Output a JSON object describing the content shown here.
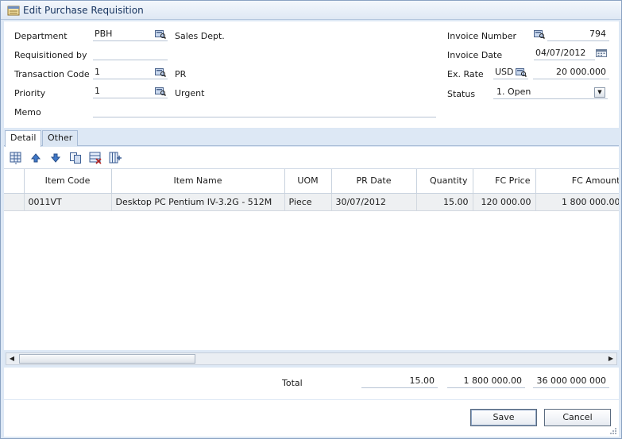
{
  "window": {
    "title": "Edit Purchase Requisition"
  },
  "form": {
    "department": {
      "label": "Department",
      "code": "PBH",
      "name": "Sales Dept."
    },
    "requisitioned_by": {
      "label": "Requisitioned by",
      "value": ""
    },
    "transaction_code": {
      "label": "Transaction Code",
      "code": "1",
      "name": "PR"
    },
    "priority": {
      "label": "Priority",
      "code": "1",
      "name": "Urgent"
    },
    "memo": {
      "label": "Memo",
      "value": ""
    },
    "invoice_number": {
      "label": "Invoice Number",
      "value": "794"
    },
    "invoice_date": {
      "label": "Invoice Date",
      "value": "04/07/2012"
    },
    "ex_rate": {
      "label": "Ex. Rate",
      "currency": "USD",
      "value": "20 000.000"
    },
    "status": {
      "label": "Status",
      "value": "1. Open"
    }
  },
  "tabs": [
    {
      "label": "Detail",
      "active": true
    },
    {
      "label": "Other",
      "active": false
    }
  ],
  "toolbar_icons": [
    "add-row-icon",
    "move-up-icon",
    "move-down-icon",
    "copy-icon",
    "delete-row-icon",
    "columns-icon"
  ],
  "grid": {
    "columns": [
      "Item Code",
      "Item Name",
      "UOM",
      "PR Date",
      "Quantity",
      "FC Price",
      "FC Amount"
    ],
    "rows": [
      {
        "item_code": "0011VT",
        "item_name": "Desktop PC Pentium IV-3.2G - 512M",
        "uom": "Piece",
        "pr_date": "30/07/2012",
        "quantity": "15.00",
        "fc_price": "120 000.00",
        "fc_amount": "1 800 000.00"
      }
    ]
  },
  "totals": {
    "label": "Total",
    "quantity": "15.00",
    "fc_amount": "1 800 000.00",
    "amount": "36 000 000 000"
  },
  "buttons": {
    "save": "Save",
    "cancel": "Cancel"
  },
  "colors": {
    "accent": "#15325e",
    "window_bg": "#dde8f5",
    "border": "#8aa2c2"
  }
}
